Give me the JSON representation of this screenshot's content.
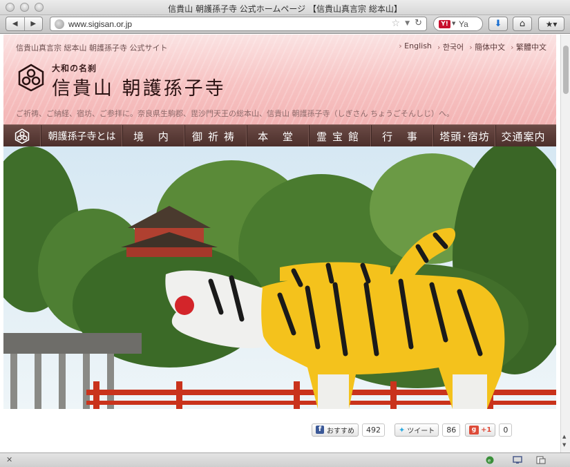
{
  "browser": {
    "window_title": "信貴山 朝護孫子寺 公式ホームページ 【信貴山真言宗 総本山】",
    "url": "www.sigisan.or.jp",
    "search_placeholder": "Ya",
    "back_icon": "back-arrow-icon",
    "forward_icon": "forward-arrow-icon"
  },
  "site": {
    "top_text": "信貴山真言宗 総本山 朝護孫子寺 公式サイト",
    "languages": [
      "English",
      "한국어",
      "簡体中文",
      "繁體中文"
    ],
    "motto": "大和の名刹",
    "temple_name": "信貴山 朝護孫子寺",
    "tagline": "ご祈祷、ご納経、宿坊、ご参拝に。奈良県生駒郡、毘沙門天王の総本山、信貴山 朝護孫子寺（しぎさん ちょうごそんしじ）へ。",
    "menu": [
      "朝護孫子寺とは",
      "境 内",
      "御祈祷",
      "本 堂",
      "霊宝館",
      "行 事",
      "塔頭･宿坊",
      "交通案内"
    ]
  },
  "social": {
    "facebook_label": "おすすめ",
    "facebook_count": "492",
    "twitter_label": "ツイート",
    "twitter_count": "86",
    "google_label": "+1",
    "google_count": "0"
  },
  "colors": {
    "menu_bg": "#5a3a36",
    "header_pink": "#f7c3c3"
  }
}
